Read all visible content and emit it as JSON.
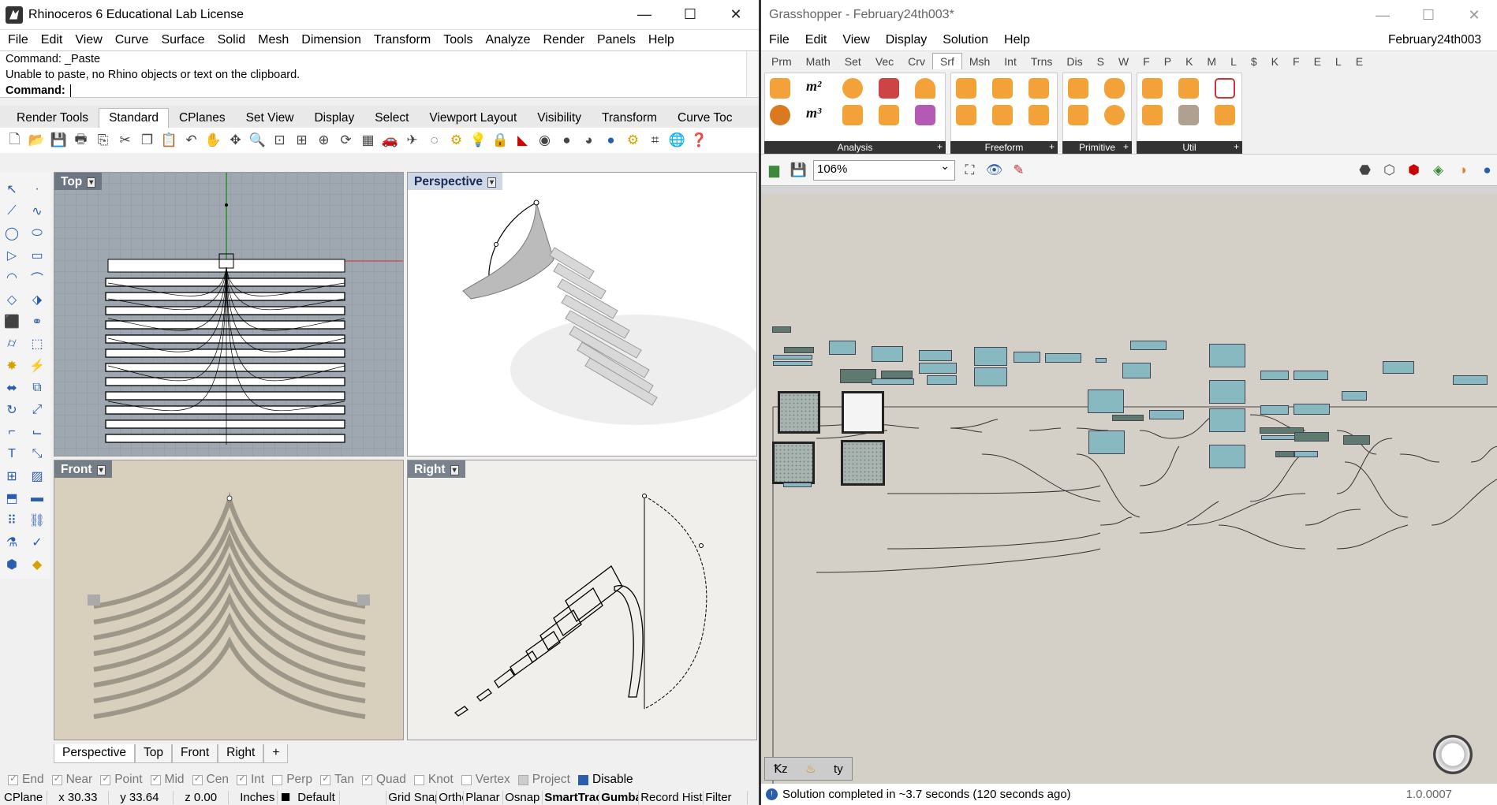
{
  "rhino": {
    "title": "Rhinoceros 6 Educational Lab License",
    "menu": [
      "File",
      "Edit",
      "View",
      "Curve",
      "Surface",
      "Solid",
      "Mesh",
      "Dimension",
      "Transform",
      "Tools",
      "Analyze",
      "Render",
      "Panels",
      "Help"
    ],
    "command_history": [
      "Command: _Paste",
      "Unable to paste, no Rhino objects or text on the clipboard."
    ],
    "command_prompt": "Command:",
    "toolbar_tabs": [
      "Render Tools",
      "Standard",
      "CPlanes",
      "Set View",
      "Display",
      "Select",
      "Viewport Layout",
      "Visibility",
      "Transform",
      "Curve Toc"
    ],
    "active_toolbar_tab": "Standard",
    "viewports": {
      "top": "Top",
      "perspective": "Perspective",
      "front": "Front",
      "right": "Right"
    },
    "viewport_tabs": [
      "Perspective",
      "Top",
      "Front",
      "Right"
    ],
    "osnaps": [
      {
        "label": "End",
        "checked": true
      },
      {
        "label": "Near",
        "checked": true
      },
      {
        "label": "Point",
        "checked": true
      },
      {
        "label": "Mid",
        "checked": true
      },
      {
        "label": "Cen",
        "checked": true
      },
      {
        "label": "Int",
        "checked": true
      },
      {
        "label": "Perp",
        "checked": false
      },
      {
        "label": "Tan",
        "checked": true
      },
      {
        "label": "Quad",
        "checked": true
      },
      {
        "label": "Knot",
        "checked": false
      },
      {
        "label": "Vertex",
        "checked": false
      },
      {
        "label": "Project",
        "checked": false
      },
      {
        "label": "Disable",
        "checked": true
      }
    ],
    "status": {
      "cplane": "CPlane",
      "x": "x 30.33",
      "y": "y 33.64",
      "z": "z 0.00",
      "units": "Inches",
      "layer": "Default",
      "toggles": [
        "Grid Snap",
        "Ortho",
        "Planar",
        "Osnap",
        "SmartTrack",
        "Gumball",
        "Record History",
        "Filter"
      ]
    }
  },
  "grasshopper": {
    "title": "Grasshopper - February24th003*",
    "menu": [
      "File",
      "Edit",
      "View",
      "Display",
      "Solution",
      "Help"
    ],
    "document_name": "February24th003",
    "tabs": [
      "Prm",
      "Math",
      "Set",
      "Vec",
      "Crv",
      "Srf",
      "Msh",
      "Int",
      "Trns",
      "Dis",
      "S",
      "W",
      "F",
      "P",
      "K",
      "M",
      "L",
      "$",
      "K",
      "F",
      "E",
      "L",
      "E"
    ],
    "active_tab": "Srf",
    "panels": [
      "Analysis",
      "Freeform",
      "Primitive",
      "Util"
    ],
    "zoom": "106%",
    "status_message": "Solution completed in ~3.7 seconds (120 seconds ago)",
    "version": "1.0.0007"
  }
}
